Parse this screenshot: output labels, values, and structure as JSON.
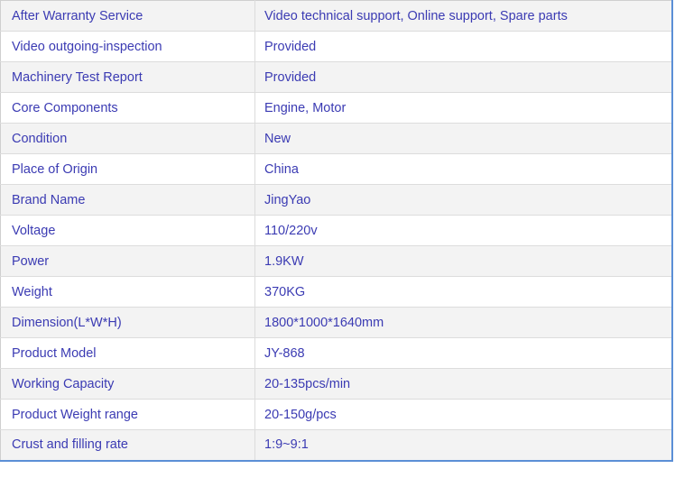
{
  "spec_rows": [
    {
      "label": "After Warranty Service",
      "value": "Video technical support, Online support, Spare parts"
    },
    {
      "label": "Video outgoing-inspection",
      "value": "Provided"
    },
    {
      "label": "Machinery Test Report",
      "value": "Provided"
    },
    {
      "label": "Core Components",
      "value": "Engine, Motor"
    },
    {
      "label": "Condition",
      "value": "New"
    },
    {
      "label": "Place of Origin",
      "value": "China"
    },
    {
      "label": "Brand Name",
      "value": "JingYao"
    },
    {
      "label": "Voltage",
      "value": "110/220v"
    },
    {
      "label": "Power",
      "value": "1.9KW"
    },
    {
      "label": "Weight",
      "value": "370KG"
    },
    {
      "label": "Dimension(L*W*H)",
      "value": "1800*1000*1640mm"
    },
    {
      "label": "Product Model",
      "value": "JY-868"
    },
    {
      "label": "Working Capacity",
      "value": "20-135pcs/min"
    },
    {
      "label": "Product Weight range",
      "value": "20-150g/pcs"
    },
    {
      "label": "Crust and filling rate",
      "value": "1:9~9:1"
    }
  ]
}
